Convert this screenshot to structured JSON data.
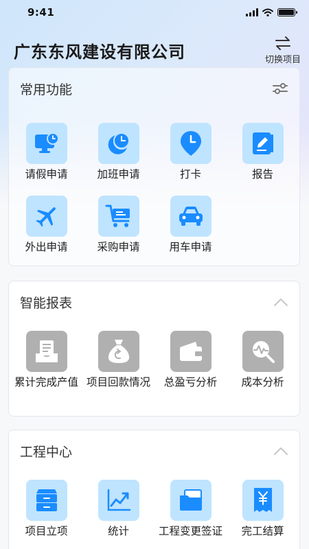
{
  "status": {
    "time": "9:41"
  },
  "header": {
    "company": "广东东风建设有限公司",
    "switch_label": "切换项目"
  },
  "common": {
    "title": "常用功能",
    "items": [
      {
        "label": "请假申请",
        "icon": "monitor-clock-icon"
      },
      {
        "label": "加班申请",
        "icon": "moon-clock-icon"
      },
      {
        "label": "打卡",
        "icon": "clock-pin-icon"
      },
      {
        "label": "报告",
        "icon": "report-book-icon"
      },
      {
        "label": "外出申请",
        "icon": "airplane-icon"
      },
      {
        "label": "采购申请",
        "icon": "shopping-cart-icon"
      },
      {
        "label": "用车申请",
        "icon": "car-icon"
      }
    ]
  },
  "reports": {
    "title": "智能报表",
    "items": [
      {
        "label": "累计完成产值",
        "icon": "document-tray-icon"
      },
      {
        "label": "项目回款情况",
        "icon": "money-bag-icon"
      },
      {
        "label": "总盈亏分析",
        "icon": "wallet-icon"
      },
      {
        "label": "成本分析",
        "icon": "magnifier-chart-icon"
      }
    ]
  },
  "engineering": {
    "title": "工程中心",
    "items": [
      {
        "label": "项目立项",
        "icon": "cabinet-icon"
      },
      {
        "label": "统计",
        "icon": "line-chart-icon"
      },
      {
        "label": "工程变更签证",
        "icon": "folder-icon"
      },
      {
        "label": "完工结算",
        "icon": "yen-receipt-icon"
      }
    ]
  },
  "colors": {
    "icon_bg_blue": "#bfe4ff",
    "icon_fg_blue": "#1a8cff",
    "icon_bg_gray": "#b0b0b0"
  }
}
